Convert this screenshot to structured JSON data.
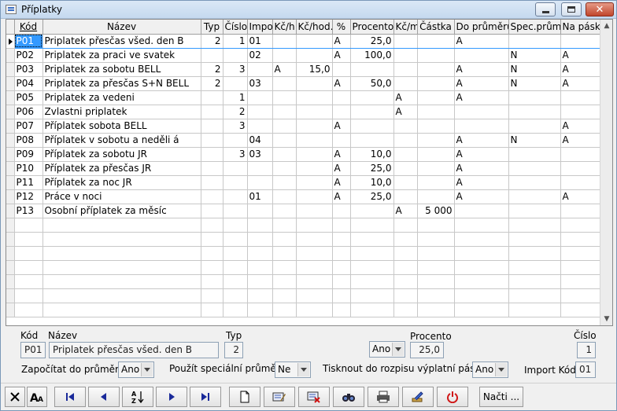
{
  "window": {
    "title": "Příplatky"
  },
  "grid": {
    "headers": {
      "kod": "Kód",
      "nazev": "Název",
      "typ": "Typ",
      "cislo": "Číslo",
      "import": "Impor",
      "kch": "Kč/h",
      "kchod": "Kč/hod.",
      "pct": "%",
      "procento": "Procento",
      "kcm": "Kč/m",
      "castka": "Částka",
      "doprum": "Do průměru",
      "specprum": "Spec.prům.",
      "napask": "Na pásk"
    },
    "rows": [
      {
        "kod": "P01",
        "nazev": "Priplatek  přesčas všed. den B",
        "typ": "2",
        "cislo": "1",
        "import": "01",
        "kch": "",
        "kchod": "",
        "pct": "A",
        "procento": "25,0",
        "kcm": "",
        "castka": "",
        "doprum": "A",
        "specprum": "",
        "napask": ""
      },
      {
        "kod": "P02",
        "nazev": "Priplatek za praci ve svatek",
        "typ": "",
        "cislo": "",
        "import": "02",
        "kch": "",
        "kchod": "",
        "pct": "A",
        "procento": "100,0",
        "kcm": "",
        "castka": "",
        "doprum": "",
        "specprum": "N",
        "napask": "A"
      },
      {
        "kod": "P03",
        "nazev": "Priplatek  za sobotu BELL",
        "typ": "2",
        "cislo": "3",
        "import": "",
        "kch": "A",
        "kchod": "15,0",
        "pct": "",
        "procento": "",
        "kcm": "",
        "castka": "",
        "doprum": "A",
        "specprum": "N",
        "napask": "A"
      },
      {
        "kod": "P04",
        "nazev": "Priplatek za přesčas S+N BELL",
        "typ": "2",
        "cislo": "",
        "import": "03",
        "kch": "",
        "kchod": "",
        "pct": "A",
        "procento": "50,0",
        "kcm": "",
        "castka": "",
        "doprum": "A",
        "specprum": "N",
        "napask": "A"
      },
      {
        "kod": "P05",
        "nazev": "Priplatek za vedeni",
        "typ": "",
        "cislo": "1",
        "import": "",
        "kch": "",
        "kchod": "",
        "pct": "",
        "procento": "",
        "kcm": "A",
        "castka": "",
        "doprum": "A",
        "specprum": "",
        "napask": ""
      },
      {
        "kod": "P06",
        "nazev": "Zvlastni priplatek",
        "typ": "",
        "cislo": "2",
        "import": "",
        "kch": "",
        "kchod": "",
        "pct": "",
        "procento": "",
        "kcm": "A",
        "castka": "",
        "doprum": "",
        "specprum": "",
        "napask": ""
      },
      {
        "kod": "P07",
        "nazev": "Příplatek sobota BELL",
        "typ": "",
        "cislo": "3",
        "import": "",
        "kch": "",
        "kchod": "",
        "pct": "A",
        "procento": "",
        "kcm": "",
        "castka": "",
        "doprum": "",
        "specprum": "",
        "napask": "A"
      },
      {
        "kod": "P08",
        "nazev": "Příplatek v sobotu a neděli á",
        "typ": "",
        "cislo": "",
        "import": "04",
        "kch": "",
        "kchod": "",
        "pct": "",
        "procento": "",
        "kcm": "",
        "castka": "",
        "doprum": "A",
        "specprum": "N",
        "napask": "A"
      },
      {
        "kod": "P09",
        "nazev": "Příplatek za sobotu JR",
        "typ": "",
        "cislo": "3",
        "import": "03",
        "kch": "",
        "kchod": "",
        "pct": "A",
        "procento": "10,0",
        "kcm": "",
        "castka": "",
        "doprum": "A",
        "specprum": "",
        "napask": ""
      },
      {
        "kod": "P10",
        "nazev": "Příplatek za přesčas JR",
        "typ": "",
        "cislo": "",
        "import": "",
        "kch": "",
        "kchod": "",
        "pct": "A",
        "procento": "25,0",
        "kcm": "",
        "castka": "",
        "doprum": "A",
        "specprum": "",
        "napask": ""
      },
      {
        "kod": "P11",
        "nazev": "Příplatek za noc JR",
        "typ": "",
        "cislo": "",
        "import": "",
        "kch": "",
        "kchod": "",
        "pct": "A",
        "procento": "10,0",
        "kcm": "",
        "castka": "",
        "doprum": "A",
        "specprum": "",
        "napask": ""
      },
      {
        "kod": "P12",
        "nazev": "Práce v noci",
        "typ": "",
        "cislo": "",
        "import": "01",
        "kch": "",
        "kchod": "",
        "pct": "A",
        "procento": "25,0",
        "kcm": "",
        "castka": "",
        "doprum": "A",
        "specprum": "",
        "napask": "A"
      },
      {
        "kod": "P13",
        "nazev": "Osobní příplatek za měsíc",
        "typ": "",
        "cislo": "",
        "import": "",
        "kch": "",
        "kchod": "",
        "pct": "",
        "procento": "",
        "kcm": "A",
        "castka": "5 000",
        "doprum": "",
        "specprum": "",
        "napask": ""
      }
    ]
  },
  "form": {
    "kod_label": "Kód",
    "kod_value": "P01",
    "nazev_label": "Název",
    "nazev_value": "Priplatek  přesčas všed. den B",
    "typ_label": "Typ",
    "typ_value": "2",
    "procento_label": "Procento",
    "procento_mode": "Ano",
    "procento_value": "25,0",
    "cislo_label": "Číslo",
    "cislo_value": "1",
    "zapocitat_label": "Započítat do průměru",
    "zapocitat_value": "Ano",
    "specprum_label": "Použít speciální průměr",
    "specprum_value": "Ne",
    "tisk_label": "Tisknout do rozpisu výplatní pásky",
    "tisk_value": "Ano",
    "import_label": "Import Kód",
    "import_value": "01"
  },
  "toolbar": {
    "nacti_label": "Načti ..."
  },
  "colors": {
    "selection": "#3399ff",
    "grid_line": "#c8c8c8",
    "window_bg": "#f0f0f0"
  }
}
